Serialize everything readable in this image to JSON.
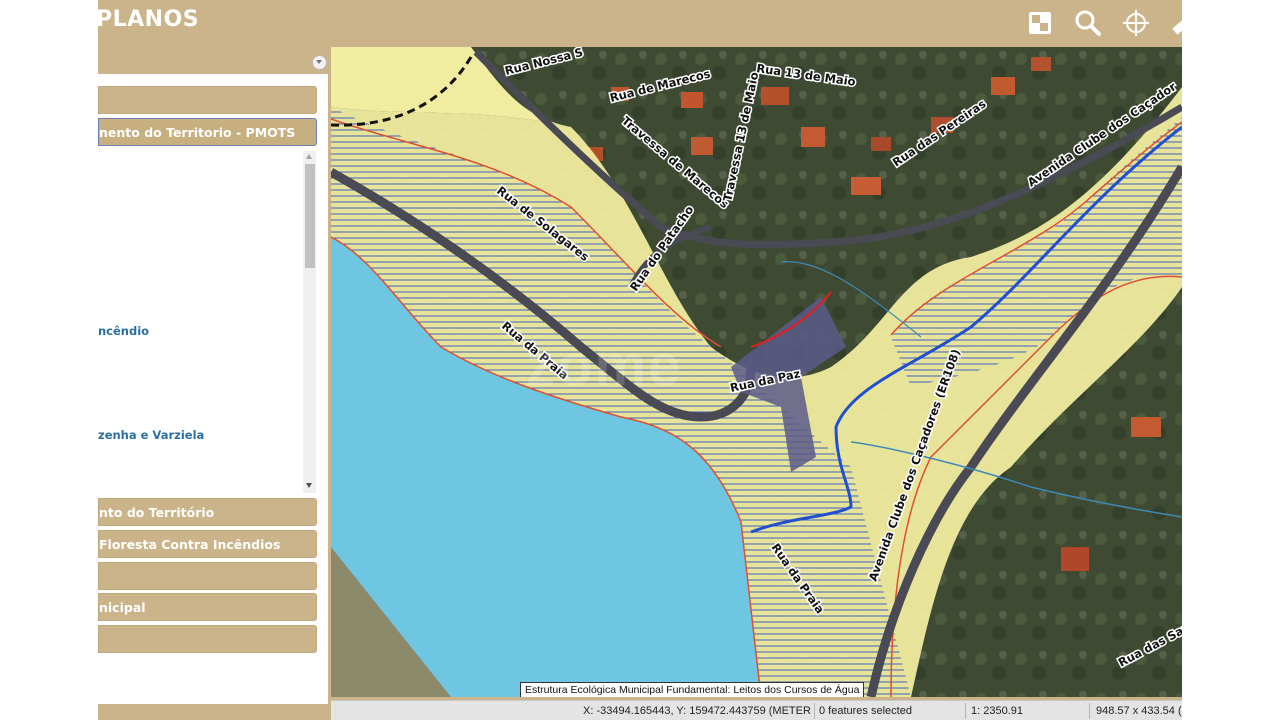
{
  "header": {
    "title": "PLANOS",
    "tools": [
      {
        "name": "overview-map-icon"
      },
      {
        "name": "search-icon"
      },
      {
        "name": "crosshair-icon"
      },
      {
        "name": "measure-icon"
      }
    ]
  },
  "sidebar": {
    "top_sections": [
      {
        "label": ""
      },
      {
        "label": "nento do Territorio - PMOTS"
      }
    ],
    "list_items": [
      {
        "label": "ncêndio"
      },
      {
        "label": "zenha e Varziela"
      }
    ],
    "bottom_sections": [
      {
        "label": "nto do Território"
      },
      {
        "label": "Floresta Contra Incêndios"
      },
      {
        "label": ""
      },
      {
        "label": "nicipal"
      },
      {
        "label": ""
      }
    ]
  },
  "map": {
    "watermark": "zome",
    "streets": [
      "Rua Nossa S",
      "Rua 13 de Maio",
      "Rua de Marecos",
      "Travessa de Marecos",
      "Travessa 13 de Maio",
      "Rua das Pereiras",
      "Avenida Clube dos Caçador",
      "Rua de Solagares",
      "Rua do Patacho",
      "Rua da Praia",
      "Rua da Paz",
      "Avenida Clube dos Caçadores (ER108)",
      "Rua da Praia",
      "Rua das Sanja"
    ],
    "tooltip": "Estrutura Ecológica Municipal Fundamental: Leitos dos Cursos de Água",
    "colors": {
      "water": "#6ec6e3",
      "reserve": "#f0eca0",
      "hatch": "#4060c0",
      "boundary": "#e05030",
      "river": "#2050d0"
    }
  },
  "statusbar": {
    "coords": "X: -33494.165443, Y: 159472.443759 (METER)",
    "selection": "0 features selected",
    "scale": "1: 2350.91",
    "extent": "948.57 x 433.54 (m"
  }
}
